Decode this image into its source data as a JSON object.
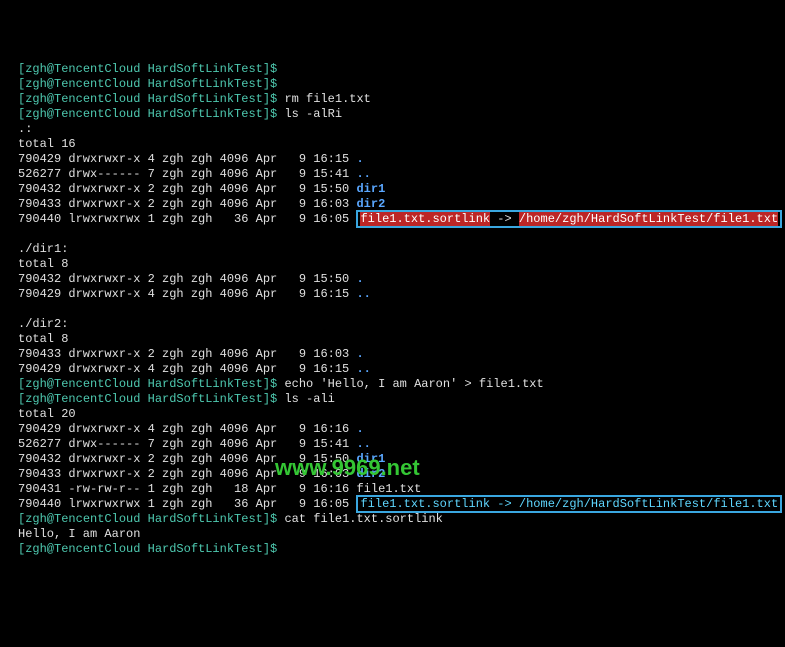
{
  "prompt": {
    "open": "[",
    "user_host": "zgh@TencentCloud",
    "dir": "HardSoftLinkTest",
    "close": "]",
    "sigil": "$"
  },
  "cmds": {
    "rm": "rm file1.txt",
    "ls_alRi": "ls -alRi",
    "echo": "echo 'Hello, I am Aaron' > file1.txt",
    "ls_ali": "ls -ali",
    "cat": "cat file1.txt.sortlink"
  },
  "listing1": {
    "header_dot": ".:",
    "total": "total 16",
    "rows": [
      {
        "inode": "790429",
        "perm": "drwxrwxr-x",
        "n": "4",
        "u": "zgh",
        "g": "zgh",
        "sz": "4096",
        "mon": "Apr",
        "day": "  9",
        "time": "16:15",
        "name": ".",
        "type": "dot"
      },
      {
        "inode": "526277",
        "perm": "drwx------",
        "n": "7",
        "u": "zgh",
        "g": "zgh",
        "sz": "4096",
        "mon": "Apr",
        "day": "  9",
        "time": "15:41",
        "name": "..",
        "type": "parent"
      },
      {
        "inode": "790432",
        "perm": "drwxrwxr-x",
        "n": "2",
        "u": "zgh",
        "g": "zgh",
        "sz": "4096",
        "mon": "Apr",
        "day": "  9",
        "time": "15:50",
        "name": "dir1",
        "type": "dir"
      },
      {
        "inode": "790433",
        "perm": "drwxrwxr-x",
        "n": "2",
        "u": "zgh",
        "g": "zgh",
        "sz": "4096",
        "mon": "Apr",
        "day": "  9",
        "time": "16:03",
        "name": "dir2",
        "type": "dir"
      }
    ],
    "symlink_row": {
      "inode": "790440",
      "perm": "lrwxrwxrwx",
      "n": "1",
      "u": "zgh",
      "g": "zgh",
      "sz": "  36",
      "mon": "Apr",
      "day": "  9",
      "time": "16:05",
      "name": "file1.txt.sortlink",
      "arrow": " -> ",
      "target": "/home/zgh/HardSoftLinkTest/file1.txt"
    }
  },
  "dir1": {
    "header": "./dir1:",
    "total": "total 8",
    "rows": [
      {
        "inode": "790432",
        "perm": "drwxrwxr-x",
        "n": "2",
        "u": "zgh",
        "g": "zgh",
        "sz": "4096",
        "mon": "Apr",
        "day": "  9",
        "time": "15:50",
        "name": ".",
        "type": "dot"
      },
      {
        "inode": "790429",
        "perm": "drwxrwxr-x",
        "n": "4",
        "u": "zgh",
        "g": "zgh",
        "sz": "4096",
        "mon": "Apr",
        "day": "  9",
        "time": "16:15",
        "name": "..",
        "type": "parent"
      }
    ]
  },
  "dir2": {
    "header": "./dir2:",
    "total": "total 8",
    "rows": [
      {
        "inode": "790433",
        "perm": "drwxrwxr-x",
        "n": "2",
        "u": "zgh",
        "g": "zgh",
        "sz": "4096",
        "mon": "Apr",
        "day": "  9",
        "time": "16:03",
        "name": ".",
        "type": "dot"
      },
      {
        "inode": "790429",
        "perm": "drwxrwxr-x",
        "n": "4",
        "u": "zgh",
        "g": "zgh",
        "sz": "4096",
        "mon": "Apr",
        "day": "  9",
        "time": "16:15",
        "name": "..",
        "type": "parent"
      }
    ]
  },
  "listing2": {
    "total": "total 20",
    "rows": [
      {
        "inode": "790429",
        "perm": "drwxrwxr-x",
        "n": "4",
        "u": "zgh",
        "g": "zgh",
        "sz": "4096",
        "mon": "Apr",
        "day": "  9",
        "time": "16:16",
        "name": ".",
        "type": "dot"
      },
      {
        "inode": "526277",
        "perm": "drwx------",
        "n": "7",
        "u": "zgh",
        "g": "zgh",
        "sz": "4096",
        "mon": "Apr",
        "day": "  9",
        "time": "15:41",
        "name": "..",
        "type": "parent"
      },
      {
        "inode": "790432",
        "perm": "drwxrwxr-x",
        "n": "2",
        "u": "zgh",
        "g": "zgh",
        "sz": "4096",
        "mon": "Apr",
        "day": "  9",
        "time": "15:50",
        "name": "dir1",
        "type": "dir"
      },
      {
        "inode": "790433",
        "perm": "drwxrwxr-x",
        "n": "2",
        "u": "zgh",
        "g": "zgh",
        "sz": "4096",
        "mon": "Apr",
        "day": "  9",
        "time": "16:03",
        "name": "dir2",
        "type": "dir"
      },
      {
        "inode": "790431",
        "perm": "-rw-rw-r--",
        "n": "1",
        "u": "zgh",
        "g": "zgh",
        "sz": "  18",
        "mon": "Apr",
        "day": "  9",
        "time": "16:16",
        "name": "file1.txt",
        "type": "file"
      }
    ],
    "symlink_row": {
      "inode": "790440",
      "perm": "lrwxrwxrwx",
      "n": "1",
      "u": "zgh",
      "g": "zgh",
      "sz": "  36",
      "mon": "Apr",
      "day": "  9",
      "time": "16:05",
      "name": "file1.txt.sortlink",
      "arrow": " -> ",
      "target": "/home/zgh/HardSoftLinkTest/file1.txt"
    }
  },
  "cat_output": "Hello, I am Aaron",
  "watermark": "www.9969.net"
}
